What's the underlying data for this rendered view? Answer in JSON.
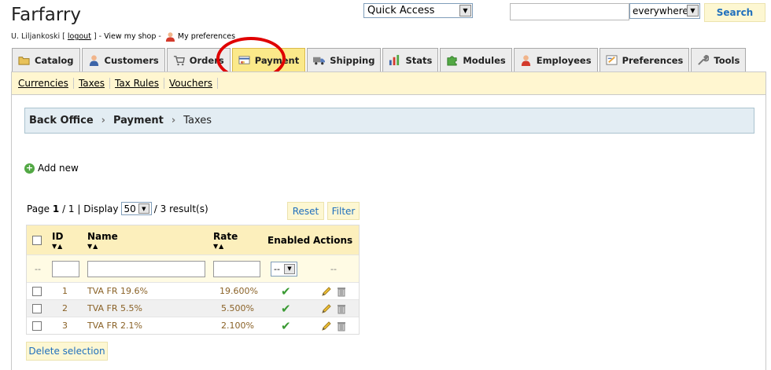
{
  "header": {
    "shop_name": "Farfarry",
    "user_name": "U. Liljankoski",
    "logout_label": "logout",
    "view_shop_label": "View my shop",
    "preferences_label": "My preferences"
  },
  "quick_access": {
    "label": "Quick Access"
  },
  "search": {
    "value": "",
    "scope": "everywhere",
    "button_label": "Search"
  },
  "tabs": [
    {
      "label": "Catalog",
      "icon": "folder-icon"
    },
    {
      "label": "Customers",
      "icon": "customer-icon"
    },
    {
      "label": "Orders",
      "icon": "cart-icon"
    },
    {
      "label": "Payment",
      "icon": "payment-icon",
      "active": true
    },
    {
      "label": "Shipping",
      "icon": "truck-icon"
    },
    {
      "label": "Stats",
      "icon": "chart-icon"
    },
    {
      "label": "Modules",
      "icon": "puzzle-icon"
    },
    {
      "label": "Employees",
      "icon": "employee-icon"
    },
    {
      "label": "Preferences",
      "icon": "preferences-icon"
    },
    {
      "label": "Tools",
      "icon": "wrench-icon"
    }
  ],
  "subtabs": [
    "Currencies",
    "Taxes",
    "Tax Rules",
    "Vouchers"
  ],
  "breadcrumb": {
    "root": "Back Office",
    "section": "Payment",
    "current": "Taxes"
  },
  "add_new_label": "Add new",
  "pager": {
    "page_prefix": "Page",
    "page": "1",
    "page_total": "/ 1 |",
    "display_label": "Display",
    "display_value": "50",
    "results": "/ 3 result(s)"
  },
  "filter_buttons": {
    "reset": "Reset",
    "filter": "Filter"
  },
  "table": {
    "columns": {
      "id": "ID",
      "name": "Name",
      "rate": "Rate",
      "enabled": "Enabled",
      "actions": "Actions"
    },
    "filter_placeholder": "--",
    "enabled_filter_value": "--",
    "rows": [
      {
        "id": "1",
        "name": "TVA FR 19.6%",
        "rate": "19.600%",
        "enabled": true
      },
      {
        "id": "2",
        "name": "TVA FR 5.5%",
        "rate": "5.500%",
        "enabled": true
      },
      {
        "id": "3",
        "name": "TVA FR 2.1%",
        "rate": "2.100%",
        "enabled": true
      }
    ]
  },
  "delete_selection_label": "Delete selection",
  "colors": {
    "active_tab": "#fbe98a",
    "highlight_circle": "#e00000",
    "link_blue": "#1f6fbd",
    "rate_text": "#8a6227"
  }
}
